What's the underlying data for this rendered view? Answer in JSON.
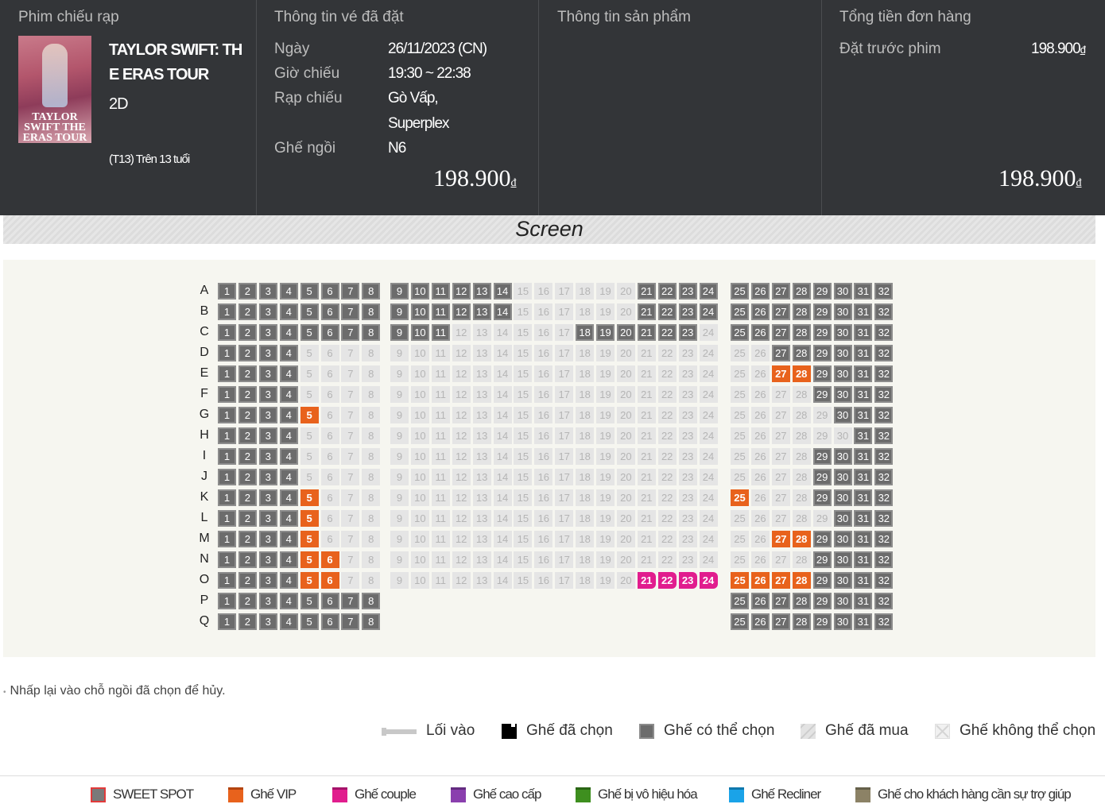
{
  "summary": {
    "cinema_col": {
      "title": "Phim chiếu rạp",
      "movie_title": "TAYLOR SWIFT: THE ERAS TOUR",
      "format": "2D",
      "rating": "(T13) Trên 13 tuổi",
      "poster_text": "TAYLOR SWIFT THE ERAS TOUR"
    },
    "ticket_col": {
      "title": "Thông tin vé đã đặt",
      "date_label": "Ngày",
      "date_value": "26/11/2023 (CN)",
      "time_label": "Giờ chiếu",
      "time_value": "19:30 ~ 22:38",
      "theater_label": "Rạp chiếu",
      "theater_value_1": "Gò Vấp,",
      "theater_value_2": "Superplex",
      "seat_label": "Ghế ngồi",
      "seat_value": "N6",
      "price": "198.900",
      "currency": "đ"
    },
    "product_col": {
      "title": "Thông tin sản phẩm"
    },
    "total_col": {
      "title": "Tổng tiền đơn hàng",
      "preorder_label": "Đặt trước phim",
      "preorder_value": "198.900",
      "currency": "đ",
      "total": "198.900"
    }
  },
  "screen_label": "Screen",
  "seatmap": {
    "rows": [
      "A",
      "B",
      "C",
      "D",
      "E",
      "F",
      "G",
      "H",
      "I",
      "J",
      "K",
      "L",
      "M",
      "N",
      "O",
      "P",
      "Q"
    ],
    "available": {
      "A": "1-14,21-32",
      "B": "1-14,21-32",
      "C": "1-11,18-23,25-32",
      "D": "1-4,27-32",
      "E": "1-4,29-32",
      "F": "1-4,29-32",
      "G": "1-4,30-32",
      "H": "1-4,31-32",
      "I": "1-4,29-32",
      "J": "1-4,29-32",
      "K": "1-4,29-32",
      "L": "1-4,30-32",
      "M": "1-4,29-32",
      "N": "1-4,29-32",
      "O": "1-4,29-32",
      "P": "1-8,25-32",
      "Q": "1-8,25-32"
    },
    "vip": {
      "E": "27-28",
      "G": "5",
      "K": "5,25",
      "L": "5",
      "M": "5,27-28",
      "N": "5-6",
      "O": "5-6,25-28"
    },
    "couple": {
      "O": "21-24"
    },
    "missing": {
      "P": "9-24",
      "Q": "9-24"
    }
  },
  "note": "Nhấp lại vào chỗ ngồi đã chọn để hủy.",
  "legend_status": {
    "entrance": "Lối vào",
    "selected": "Ghế đã chọn",
    "available": "Ghế có thể chọn",
    "sold": "Ghế đã mua",
    "unavailable": "Ghế không thể chọn"
  },
  "legend_types": [
    {
      "label": "SWEET SPOT",
      "color": "#e23b3b"
    },
    {
      "label": "Ghế VIP",
      "color": "#e8621c"
    },
    {
      "label": "Ghế couple",
      "color": "#e11d8e"
    },
    {
      "label": "Ghế cao cấp",
      "color": "#8a3fae"
    },
    {
      "label": "Ghế bị vô hiệu hóa",
      "color": "#3e8f1f"
    },
    {
      "label": "Ghế Recliner",
      "color": "#1aa3e8"
    },
    {
      "label": "Ghế cho khách hàng cần sự trợ giúp",
      "color": "#8c8266"
    }
  ]
}
